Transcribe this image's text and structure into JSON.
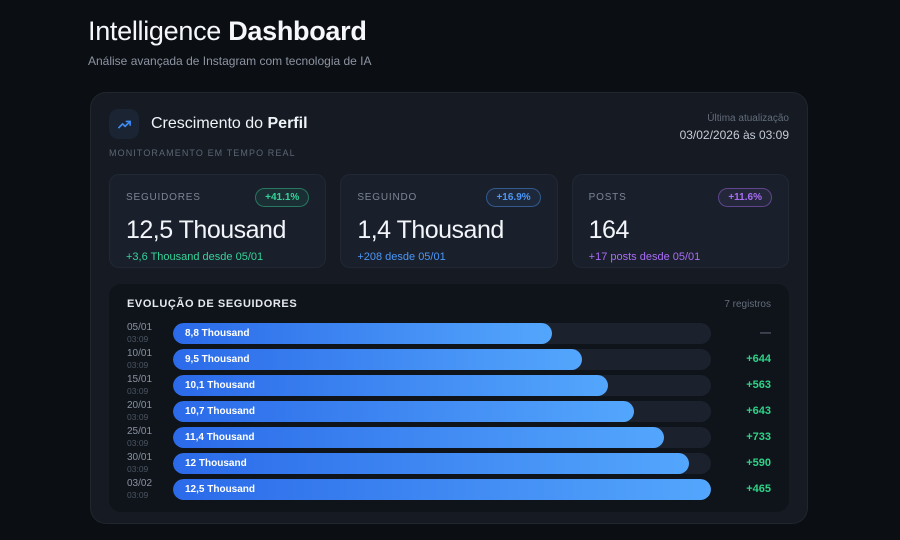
{
  "page": {
    "title_light": "Intelligence",
    "title_bold": "Dashboard",
    "subtitle": "Análise avançada de Instagram com tecnologia de IA"
  },
  "panel": {
    "title_normal": "Crescimento do",
    "title_bold": "Perfil",
    "icon": "trending-up-icon",
    "subtitle": "MONITORAMENTO EM TEMPO REAL",
    "last_update_label": "Última atualização",
    "last_update_value": "03/02/2026 às 03:09"
  },
  "stats": [
    {
      "label": "SEGUIDORES",
      "badge": "+41.1%",
      "value": "12,5 Thousand",
      "delta": "+3,6 Thousand desde 05/01",
      "color": "#34d399"
    },
    {
      "label": "SEGUINDO",
      "badge": "+16.9%",
      "value": "1,4 Thousand",
      "delta": "+208 desde 05/01",
      "color": "#4b96f8"
    },
    {
      "label": "POSTS",
      "badge": "+11.6%",
      "value": "164",
      "delta": "+17 posts desde 05/01",
      "color": "#a86df5"
    }
  ],
  "chart_data": {
    "type": "bar",
    "orientation": "horizontal",
    "title": "EVOLUÇÃO DE SEGUIDORES",
    "records_label": "7 registros",
    "xlim": [
      0,
      12500
    ],
    "categories": [
      "05/01",
      "10/01",
      "15/01",
      "20/01",
      "25/01",
      "30/01",
      "03/02"
    ],
    "values": [
      8800,
      9500,
      10100,
      10700,
      11400,
      12000,
      12500
    ],
    "rows": [
      {
        "date": "05/01",
        "time": "03:09",
        "label": "8,8 Thousand",
        "value": 8800,
        "delta": "—"
      },
      {
        "date": "10/01",
        "time": "03:09",
        "label": "9,5 Thousand",
        "value": 9500,
        "delta": "+644"
      },
      {
        "date": "15/01",
        "time": "03:09",
        "label": "10,1 Thousand",
        "value": 10100,
        "delta": "+563"
      },
      {
        "date": "20/01",
        "time": "03:09",
        "label": "10,7 Thousand",
        "value": 10700,
        "delta": "+643"
      },
      {
        "date": "25/01",
        "time": "03:09",
        "label": "11,4 Thousand",
        "value": 11400,
        "delta": "+733"
      },
      {
        "date": "30/01",
        "time": "03:09",
        "label": "12 Thousand",
        "value": 12000,
        "delta": "+590"
      },
      {
        "date": "03/02",
        "time": "03:09",
        "label": "12,5 Thousand",
        "value": 12500,
        "delta": "+465"
      }
    ]
  },
  "colors": {
    "background": "#0b0e13",
    "card": "#151a23",
    "stat_card": "#1a202b",
    "chart_panel": "#0f141b",
    "bar_track": "#1c222d",
    "bar_gradient_start": "#2b6ae9",
    "bar_gradient_end": "#53a6fc",
    "delta_positive": "#2ed388",
    "delta_muted": "#5a6270",
    "icon_blue": "#3f8cf3"
  }
}
